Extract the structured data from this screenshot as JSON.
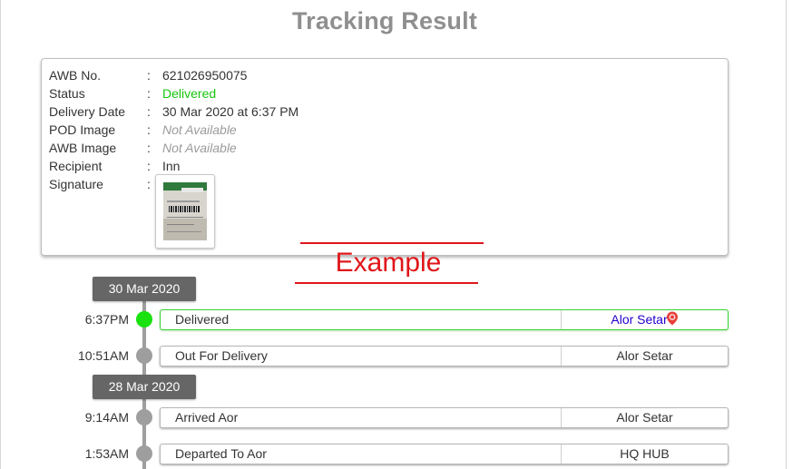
{
  "page": {
    "title": "Tracking Result"
  },
  "shipment": {
    "fields": [
      {
        "label": "AWB No.",
        "colon": ":",
        "value": "621026950075"
      },
      {
        "label": "Status",
        "colon": ":",
        "value": "Delivered"
      },
      {
        "label": "Delivery Date",
        "colon": ":",
        "value": "30 Mar 2020 at 6:37 PM"
      },
      {
        "label": "POD Image",
        "colon": ":",
        "value": "Not Available"
      },
      {
        "label": "AWB Image",
        "colon": ":",
        "value": "Not Available"
      },
      {
        "label": "Recipient",
        "colon": ":",
        "value": "Inn"
      },
      {
        "label": "Signature",
        "colon": ":",
        "value": ""
      }
    ]
  },
  "watermark": {
    "text": "Example"
  },
  "timeline": {
    "groups": [
      {
        "date": "30 Mar 2020",
        "events": [
          {
            "time": "6:37PM",
            "status": "Delivered",
            "location": "Alor Setar",
            "active": true
          },
          {
            "time": "10:51AM",
            "status": "Out For Delivery",
            "location": "Alor Setar",
            "active": false
          }
        ]
      },
      {
        "date": "28 Mar 2020",
        "events": [
          {
            "time": "9:14AM",
            "status": "Arrived Aor",
            "location": "Alor Setar",
            "active": false
          },
          {
            "time": "1:53AM",
            "status": "Departed To Aor",
            "location": "HQ HUB",
            "active": false
          }
        ]
      }
    ]
  },
  "colors": {
    "status_delivered": "#16c60c",
    "active_dot": "#19e20f",
    "date_badge": "#666666",
    "watermark": "#e0161a",
    "location_link": "#2200cc",
    "pin": "#e8403a"
  },
  "icons": {
    "location_pin": "map-pin-icon"
  }
}
